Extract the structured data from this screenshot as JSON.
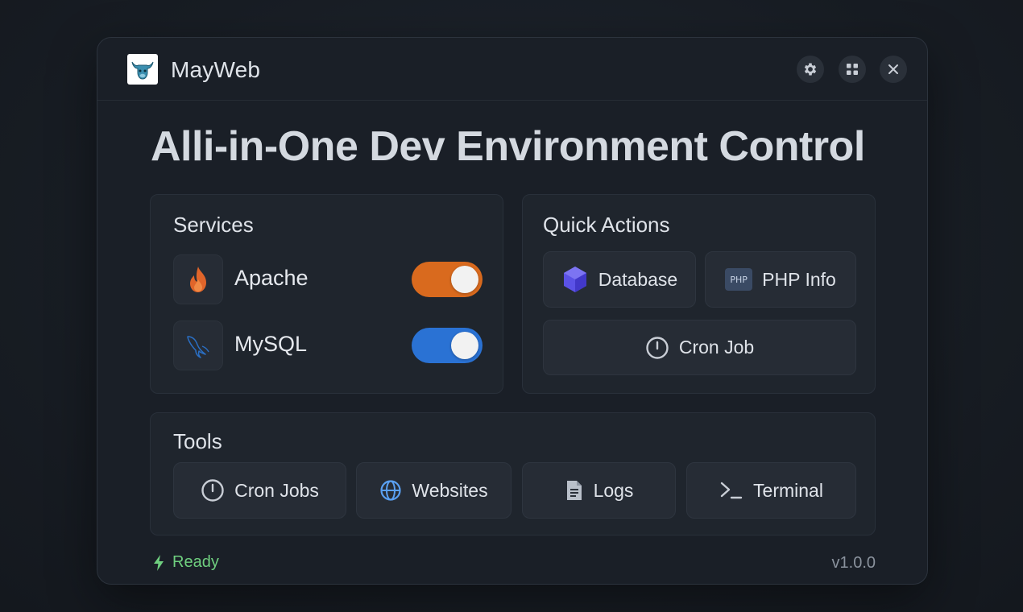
{
  "app": {
    "title": "MayWeb"
  },
  "headline": "Alli-in-One Dev Environment Control",
  "services": {
    "title": "Services",
    "items": [
      {
        "name": "Apache",
        "icon": "flame-icon",
        "enabled": true,
        "color": "#d96a1e"
      },
      {
        "name": "MySQL",
        "icon": "dolphin-icon",
        "enabled": true,
        "color": "#2a72d4"
      }
    ]
  },
  "quick_actions": {
    "title": "Quick Actions",
    "database": "Database",
    "php_info": "PHP Info",
    "php_badge": "PHP",
    "cron_job": "Cron Job"
  },
  "tools": {
    "title": "Tools",
    "cron_jobs": "Cron Jobs",
    "websites": "Websites",
    "logs": "Logs",
    "terminal": "Terminal"
  },
  "footer": {
    "status": "Ready",
    "version": "v1.0.0"
  },
  "colors": {
    "accent_orange": "#d96a1e",
    "accent_blue": "#2a72d4",
    "status_green": "#6fcf7f"
  }
}
